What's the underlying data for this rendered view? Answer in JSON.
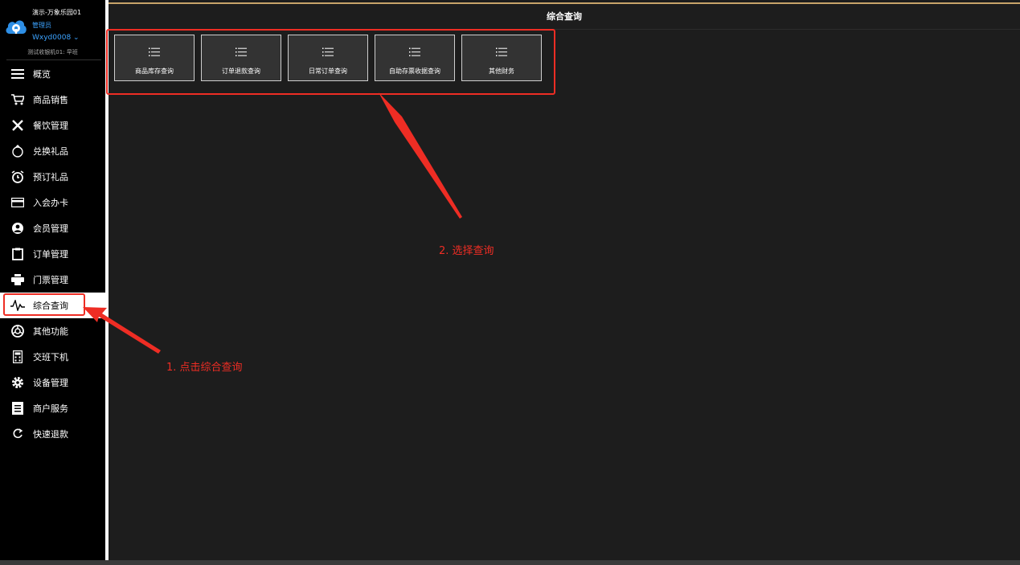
{
  "profile": {
    "store": "演示-万象乐园01",
    "role": "管理员",
    "account": "Wxyd0008 ⌄",
    "terminal": "测试收银机01: 早班"
  },
  "sidebar": {
    "items": [
      {
        "label": "概览",
        "icon": "menu-icon"
      },
      {
        "label": "商品销售",
        "icon": "cart-icon"
      },
      {
        "label": "餐饮管理",
        "icon": "utensils-icon"
      },
      {
        "label": "兑换礼品",
        "icon": "gift-bag-icon"
      },
      {
        "label": "预订礼品",
        "icon": "alarm-clock-icon"
      },
      {
        "label": "入会办卡",
        "icon": "card-icon"
      },
      {
        "label": "会员管理",
        "icon": "member-icon"
      },
      {
        "label": "订单管理",
        "icon": "clipboard-icon"
      },
      {
        "label": "门票管理",
        "icon": "printer-icon"
      },
      {
        "label": "综合查询",
        "icon": "pulse-icon",
        "active": true
      },
      {
        "label": "其他功能",
        "icon": "aperture-icon"
      },
      {
        "label": "交班下机",
        "icon": "calculator-icon"
      },
      {
        "label": "设备管理",
        "icon": "gear-icon"
      },
      {
        "label": "商户服务",
        "icon": "document-icon"
      },
      {
        "label": "快速退款",
        "icon": "refresh-icon"
      }
    ]
  },
  "main": {
    "title": "综合查询",
    "tiles": [
      {
        "label": "商品库存查询",
        "icon": "list-icon"
      },
      {
        "label": "订单退款查询",
        "icon": "list-icon"
      },
      {
        "label": "日常订单查询",
        "icon": "list-icon"
      },
      {
        "label": "自助存票收据查询",
        "icon": "list-icon"
      },
      {
        "label": "其他财务",
        "icon": "list-icon"
      }
    ]
  },
  "annotations": {
    "step1": "1. 点击综合查询",
    "step2": "2. 选择查询"
  },
  "colors": {
    "annotation": "#ee2d24",
    "accent": "#3ca3ff",
    "top_line": "#c8a46a",
    "active_bg": "#ffffff"
  }
}
